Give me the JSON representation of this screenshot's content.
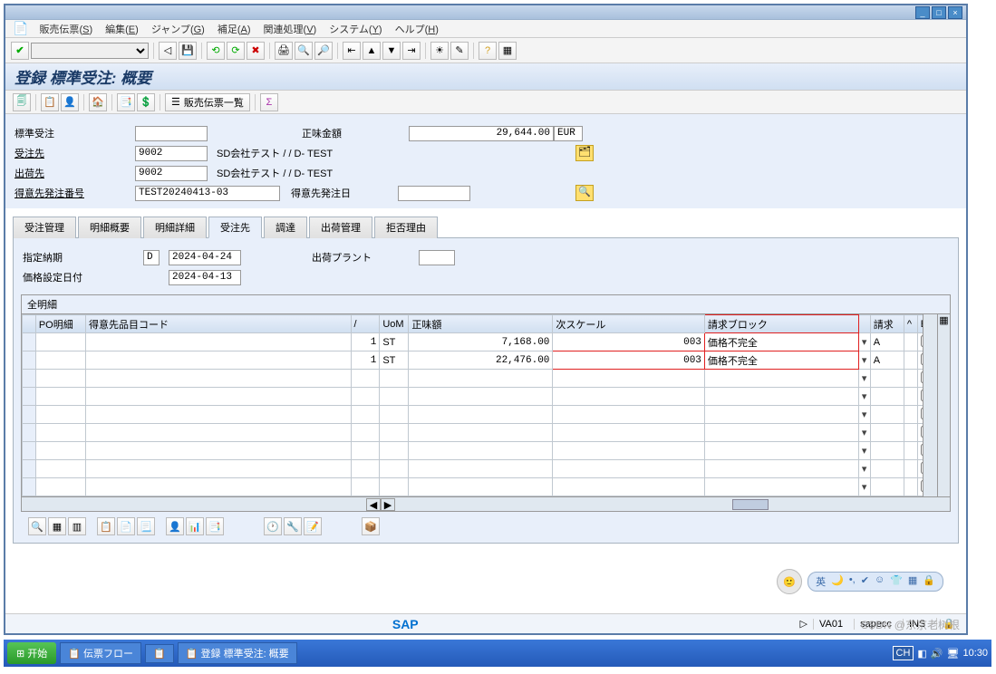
{
  "window": {
    "minimize": "_",
    "maximize": "□",
    "close": "×"
  },
  "menubar": {
    "items": [
      {
        "label": "販売伝票",
        "key": "S"
      },
      {
        "label": "編集",
        "key": "E"
      },
      {
        "label": "ジャンプ",
        "key": "G"
      },
      {
        "label": "補足",
        "key": "A"
      },
      {
        "label": "関連処理",
        "key": "V"
      },
      {
        "label": "システム",
        "key": "Y"
      },
      {
        "label": "ヘルプ",
        "key": "H"
      }
    ]
  },
  "page_title": "登録 標準受注: 概要",
  "apptoolbar": {
    "list_label": "販売伝票一覧"
  },
  "header_form": {
    "order_type_label": "標準受注",
    "order_type_value": "",
    "net_amount_label": "正味金額",
    "net_amount_value": "29,644.00",
    "currency": "EUR",
    "sold_to_label": "受注先",
    "sold_to_value": "9002",
    "sold_to_name": "SD会社テスト / / D- TEST",
    "ship_to_label": "出荷先",
    "ship_to_value": "9002",
    "ship_to_name": "SD会社テスト / / D- TEST",
    "po_label": "得意先発注番号",
    "po_value": "TEST20240413-03",
    "po_date_label": "得意先発注日",
    "po_date_value": ""
  },
  "tabs": [
    {
      "label": "受注管理",
      "active": false
    },
    {
      "label": "明細概要",
      "active": false
    },
    {
      "label": "明細詳細",
      "active": false
    },
    {
      "label": "受注先",
      "active": true
    },
    {
      "label": "調達",
      "active": false
    },
    {
      "label": "出荷管理",
      "active": false
    },
    {
      "label": "拒否理由",
      "active": false
    }
  ],
  "tab_form": {
    "req_date_label": "指定納期",
    "req_date_type": "D",
    "req_date_value": "2024-04-24",
    "plant_label": "出荷プラント",
    "plant_value": "",
    "pricing_date_label": "価格設定日付",
    "pricing_date_value": "2024-04-13"
  },
  "grid": {
    "title": "全明細",
    "columns": [
      "PO明細",
      "得意先品目コード",
      "/",
      "UoM",
      "正味額",
      "次スケール",
      "請求ブロック",
      "請求",
      "^",
      "B."
    ],
    "rows": [
      {
        "po_item": "",
        "cust_mat": "",
        "slash": "1",
        "uom": "ST",
        "net": "7,168.00",
        "scale": "003",
        "block": "価格不完全",
        "inv": "A",
        "b": false
      },
      {
        "po_item": "",
        "cust_mat": "",
        "slash": "1",
        "uom": "ST",
        "net": "22,476.00",
        "scale": "003",
        "block": "価格不完全",
        "inv": "A",
        "b": false
      }
    ],
    "empty_rows": 7
  },
  "status_bar": {
    "tcode": "VA01",
    "system": "sapecc",
    "mode": "INS"
  },
  "taskbar": {
    "start": "开始",
    "tasks": [
      "伝票フロー",
      "",
      "登録 標準受注: 概要"
    ],
    "lang": "CH",
    "time": "10:30"
  },
  "watermark": "CSDN @东京老树根"
}
